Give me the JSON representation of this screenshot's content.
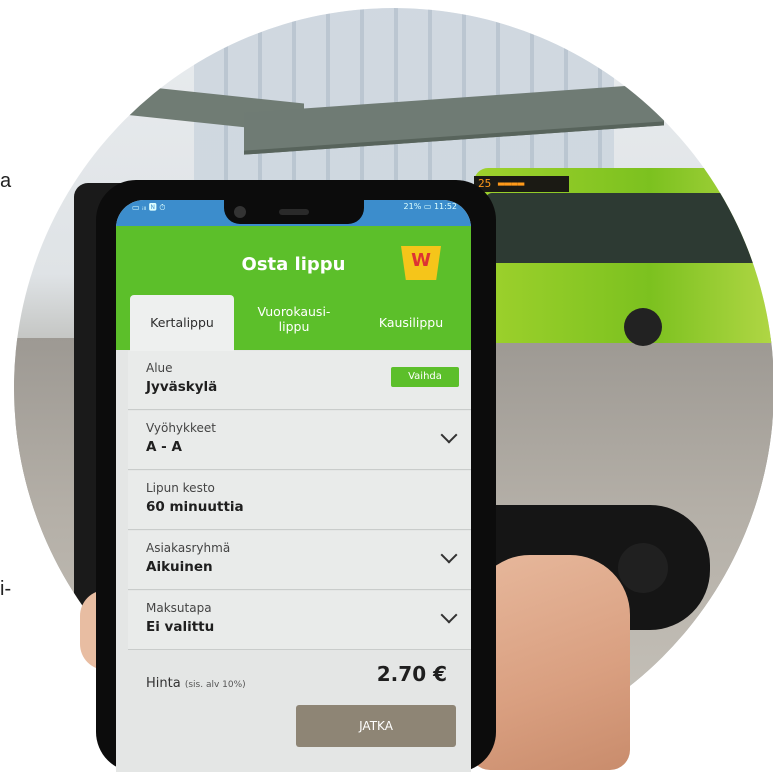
{
  "stray": {
    "a": "a",
    "i": "i-"
  },
  "bus": {
    "sign": "25 ▬▬▬▬"
  },
  "phone": {
    "status_left": "▭ ᵢₗₗ 🅽 ⏱",
    "status_right": "21% ▭ 11:52"
  },
  "app": {
    "title": "Osta lippu",
    "logo_letter": "W",
    "tabs": [
      {
        "label_1": "Kertalippu",
        "label_2": ""
      },
      {
        "label_1": "Vuorokausi-",
        "label_2": "lippu"
      },
      {
        "label_1": "Kausilippu",
        "label_2": ""
      }
    ],
    "rows": [
      {
        "label": "Alue",
        "value": "Jyväskylä",
        "action": "Vaihda"
      },
      {
        "label": "Vyöhykkeet",
        "value": "A - A"
      },
      {
        "label": "Lipun kesto",
        "value": "60 minuuttia"
      },
      {
        "label": "Asiakasryhmä",
        "value": "Aikuinen"
      },
      {
        "label": "Maksutapa",
        "value": "Ei valittu"
      }
    ],
    "price_label": "Hinta",
    "price_note": "(sis. alv 10%)",
    "price": "2.70 €",
    "continue": "JATKA"
  },
  "colors": {
    "app_green": "#5cbf2a",
    "bus_green": "#7cc11f",
    "button": "#8e8575"
  }
}
